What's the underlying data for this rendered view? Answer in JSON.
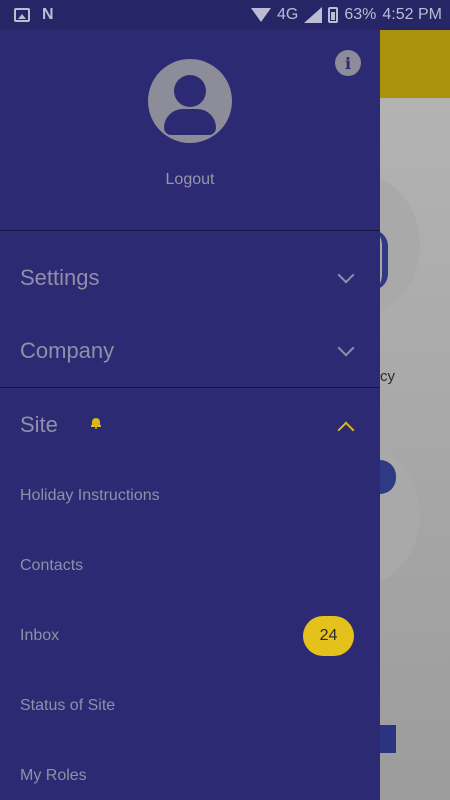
{
  "status_bar": {
    "left_icons": [
      "image-icon",
      "n-icon"
    ],
    "network": "4G",
    "battery": "63%",
    "time": "4:52 PM"
  },
  "background": {
    "partial_text": "cy"
  },
  "drawer": {
    "header": {
      "logout_label": "Logout",
      "info_glyph": "i"
    },
    "sections": [
      {
        "label": "Settings",
        "expanded": false
      },
      {
        "label": "Company",
        "expanded": false
      },
      {
        "label": "Site",
        "expanded": true,
        "has_notification": true
      }
    ],
    "site_items": [
      {
        "label": "Holiday Instructions"
      },
      {
        "label": "Contacts"
      },
      {
        "label": "Inbox",
        "badge": "24"
      },
      {
        "label": "Status of Site"
      },
      {
        "label": "My Roles"
      }
    ]
  },
  "colors": {
    "drawer_bg": "#2d2a74",
    "accent": "#e5c21b",
    "text_muted": "#8f8fa8"
  }
}
